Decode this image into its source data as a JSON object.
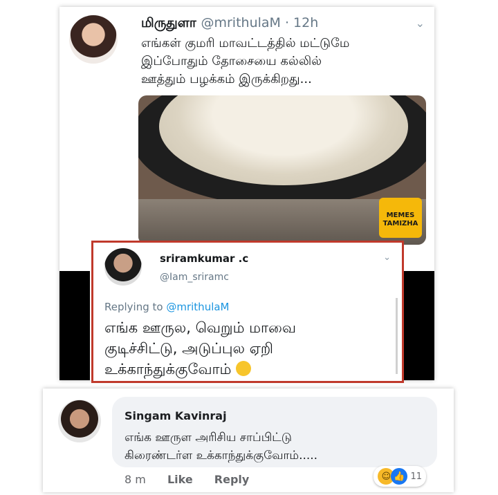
{
  "tweet": {
    "author_name": "மிருதுளா",
    "handle": "@mrithulaM · 12h",
    "text": "எங்கள் குமரி மாவட்டத்தில் மட்டுமே\nஇப்போதும் தோசையை கல்லில்\nஊத்தும் பழக்கம் இருக்கிறது...",
    "media_watermark": "MEMES TAMIZHA",
    "menu_icon": "chevron-down-icon"
  },
  "reply": {
    "author_name": "sriramkumar .c",
    "handle": "@Iam_sriramc",
    "replying_prefix": "Replying to",
    "replying_to": "@mrithulaM",
    "text": "எங்க ஊருல, வெறும் மாவை\nகுடிச்சிட்டு, அடுப்புல ஏறி\nஉக்காந்துக்குவோம்",
    "emoji": "face-with-rolling-eyes-icon",
    "menu_icon": "chevron-down-icon"
  },
  "comment": {
    "author_name": "Singam Kavinraj",
    "text": "எங்க ஊருள அரிசிய சாப்பிட்டு\nகிரைண்டர்ள உக்காந்துக்குவோம்.....",
    "time": "8 m",
    "like_label": "Like",
    "reply_label": "Reply",
    "reaction_count": "11",
    "reactions": [
      "haha-icon",
      "like-icon"
    ],
    "colors": {
      "like": "#1877f2",
      "haha": "#f7b928"
    }
  }
}
